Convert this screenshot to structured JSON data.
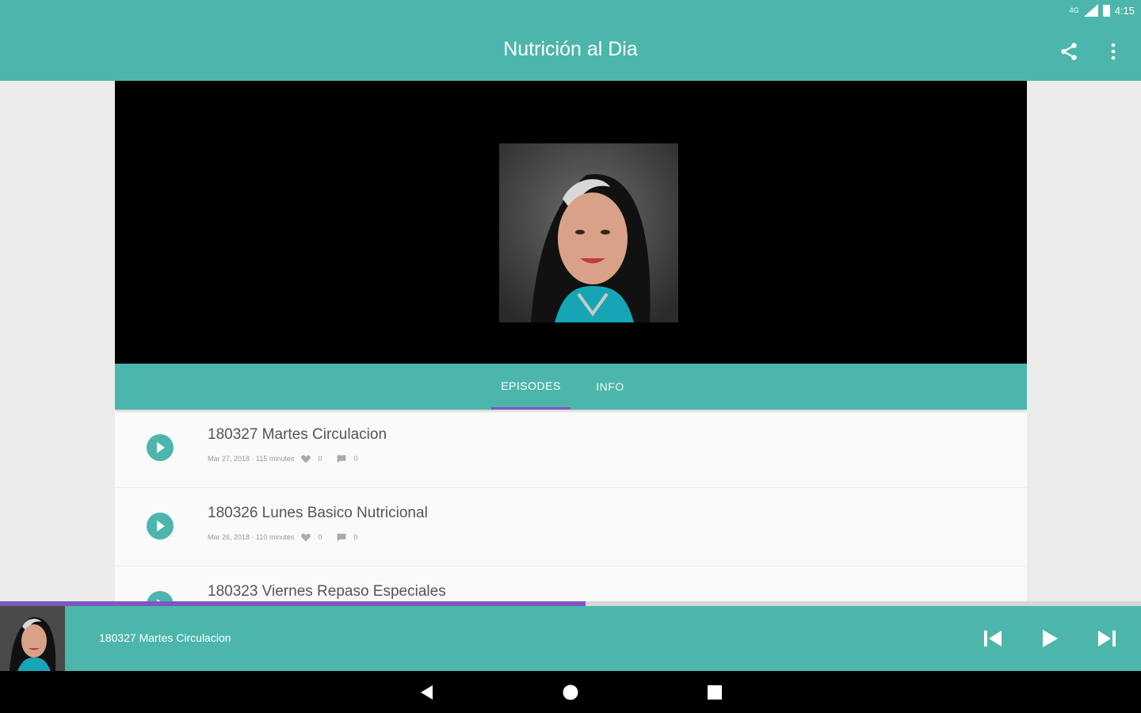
{
  "status_bar": {
    "network": "4G",
    "time": "4:15"
  },
  "app_bar": {
    "title": "Nutrición al Dia",
    "share_icon": "share-icon",
    "more_icon": "more-vert-icon"
  },
  "tabs": [
    {
      "label": "EPISODES",
      "active": true
    },
    {
      "label": "INFO",
      "active": false
    }
  ],
  "episodes": [
    {
      "title": "180327 Martes Circulacion",
      "date_duration": "Mar 27, 2018 · 115 minutes",
      "likes": "0",
      "comments": "0"
    },
    {
      "title": "180326 Lunes Basico Nutricional",
      "date_duration": "Mar 26, 2018 · 110 minutes",
      "likes": "0",
      "comments": "0"
    },
    {
      "title": "180323 Viernes Repaso Especiales",
      "date_duration": "",
      "likes": "",
      "comments": ""
    }
  ],
  "player": {
    "now_playing": "180327 Martes Circulacion",
    "progress": 0.513
  },
  "colors": {
    "primary": "#4db6ac",
    "accent": "#7e57c2"
  }
}
